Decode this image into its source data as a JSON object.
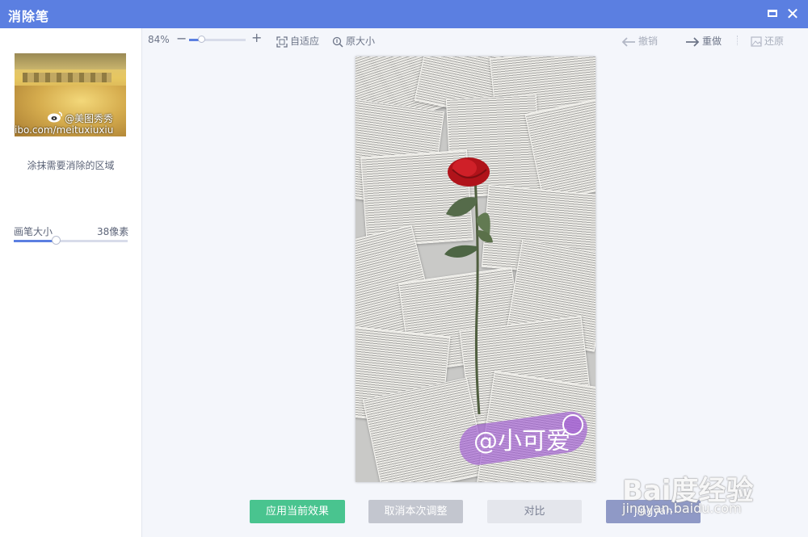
{
  "window": {
    "title": "消除笔",
    "close_glyph": "✕"
  },
  "sidebar": {
    "thumbnail": {
      "watermark_line1": "@美图秀秀",
      "watermark_line2": "ibo.com/meituxiuxiu"
    },
    "hint": "涂抹需要消除的区域",
    "brush_size": {
      "label": "画笔大小",
      "value": "38像素",
      "level": 0.37
    }
  },
  "toolbar": {
    "zoom_percent": "84%",
    "zoom_level": 0.22,
    "zoom_minus": "−",
    "zoom_plus": "+",
    "fit": "自适应",
    "original": "原大小",
    "undo": "撤销",
    "redo": "重做",
    "restore": "还原"
  },
  "canvas": {
    "watermark": "@小可爱"
  },
  "buttons": {
    "apply": "应用当前效果",
    "cancel": "取消本次调整",
    "compare": "对比",
    "save": "jingyan"
  },
  "overlay": {
    "baidu_logo": "Bai度经验",
    "baidu_url": "jingyan.baidu.com"
  },
  "colors": {
    "titlebar": "#5b7fe1",
    "apply": "#49c48f",
    "accent": "#5b7fe1"
  }
}
